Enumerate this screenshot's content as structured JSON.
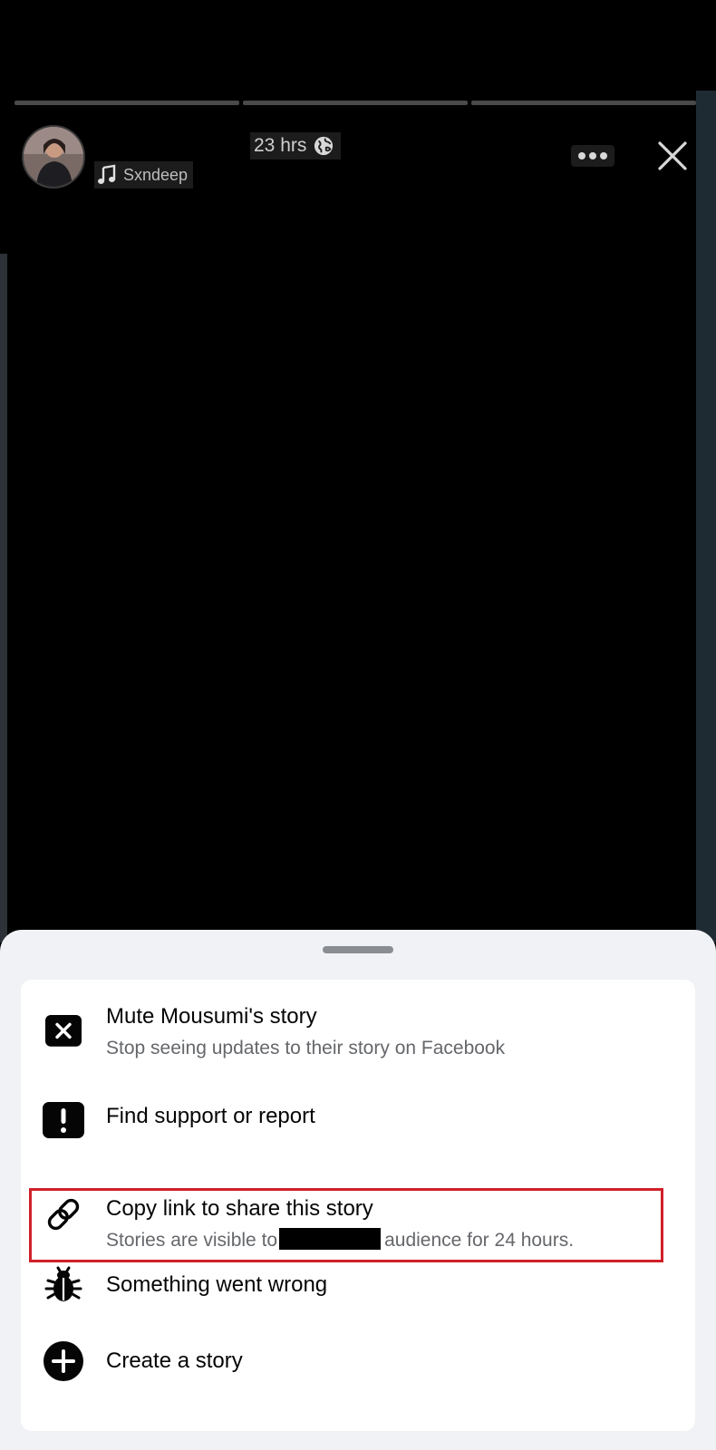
{
  "story": {
    "time": "23 hrs",
    "music": "Sxndeep",
    "progress_segments": 3,
    "icons": {
      "privacy": "globe-icon",
      "music": "music-note-icon",
      "more": "more-options-icon",
      "close": "close-icon"
    }
  },
  "sheet": {
    "items": [
      {
        "title": "Mute Mousumi's story",
        "subtitle": "Stop seeing updates to their story on Facebook",
        "icon": "mute-x-icon"
      },
      {
        "title": "Find support or report",
        "icon": "exclamation-icon"
      },
      {
        "title": "Copy link to share this story",
        "subtitle_before": "Stories are visible to",
        "subtitle_after": "audience for 24 hours.",
        "icon": "link-icon",
        "highlighted": true
      },
      {
        "title": "Something went wrong",
        "icon": "bug-icon"
      },
      {
        "title": "Create a story",
        "icon": "plus-circle-icon"
      }
    ]
  },
  "colors": {
    "sheet_bg": "#f0f2f5",
    "card_bg": "#ffffff",
    "highlight": "#d0202a",
    "primary_text": "#050505",
    "secondary_text": "#65676b"
  }
}
